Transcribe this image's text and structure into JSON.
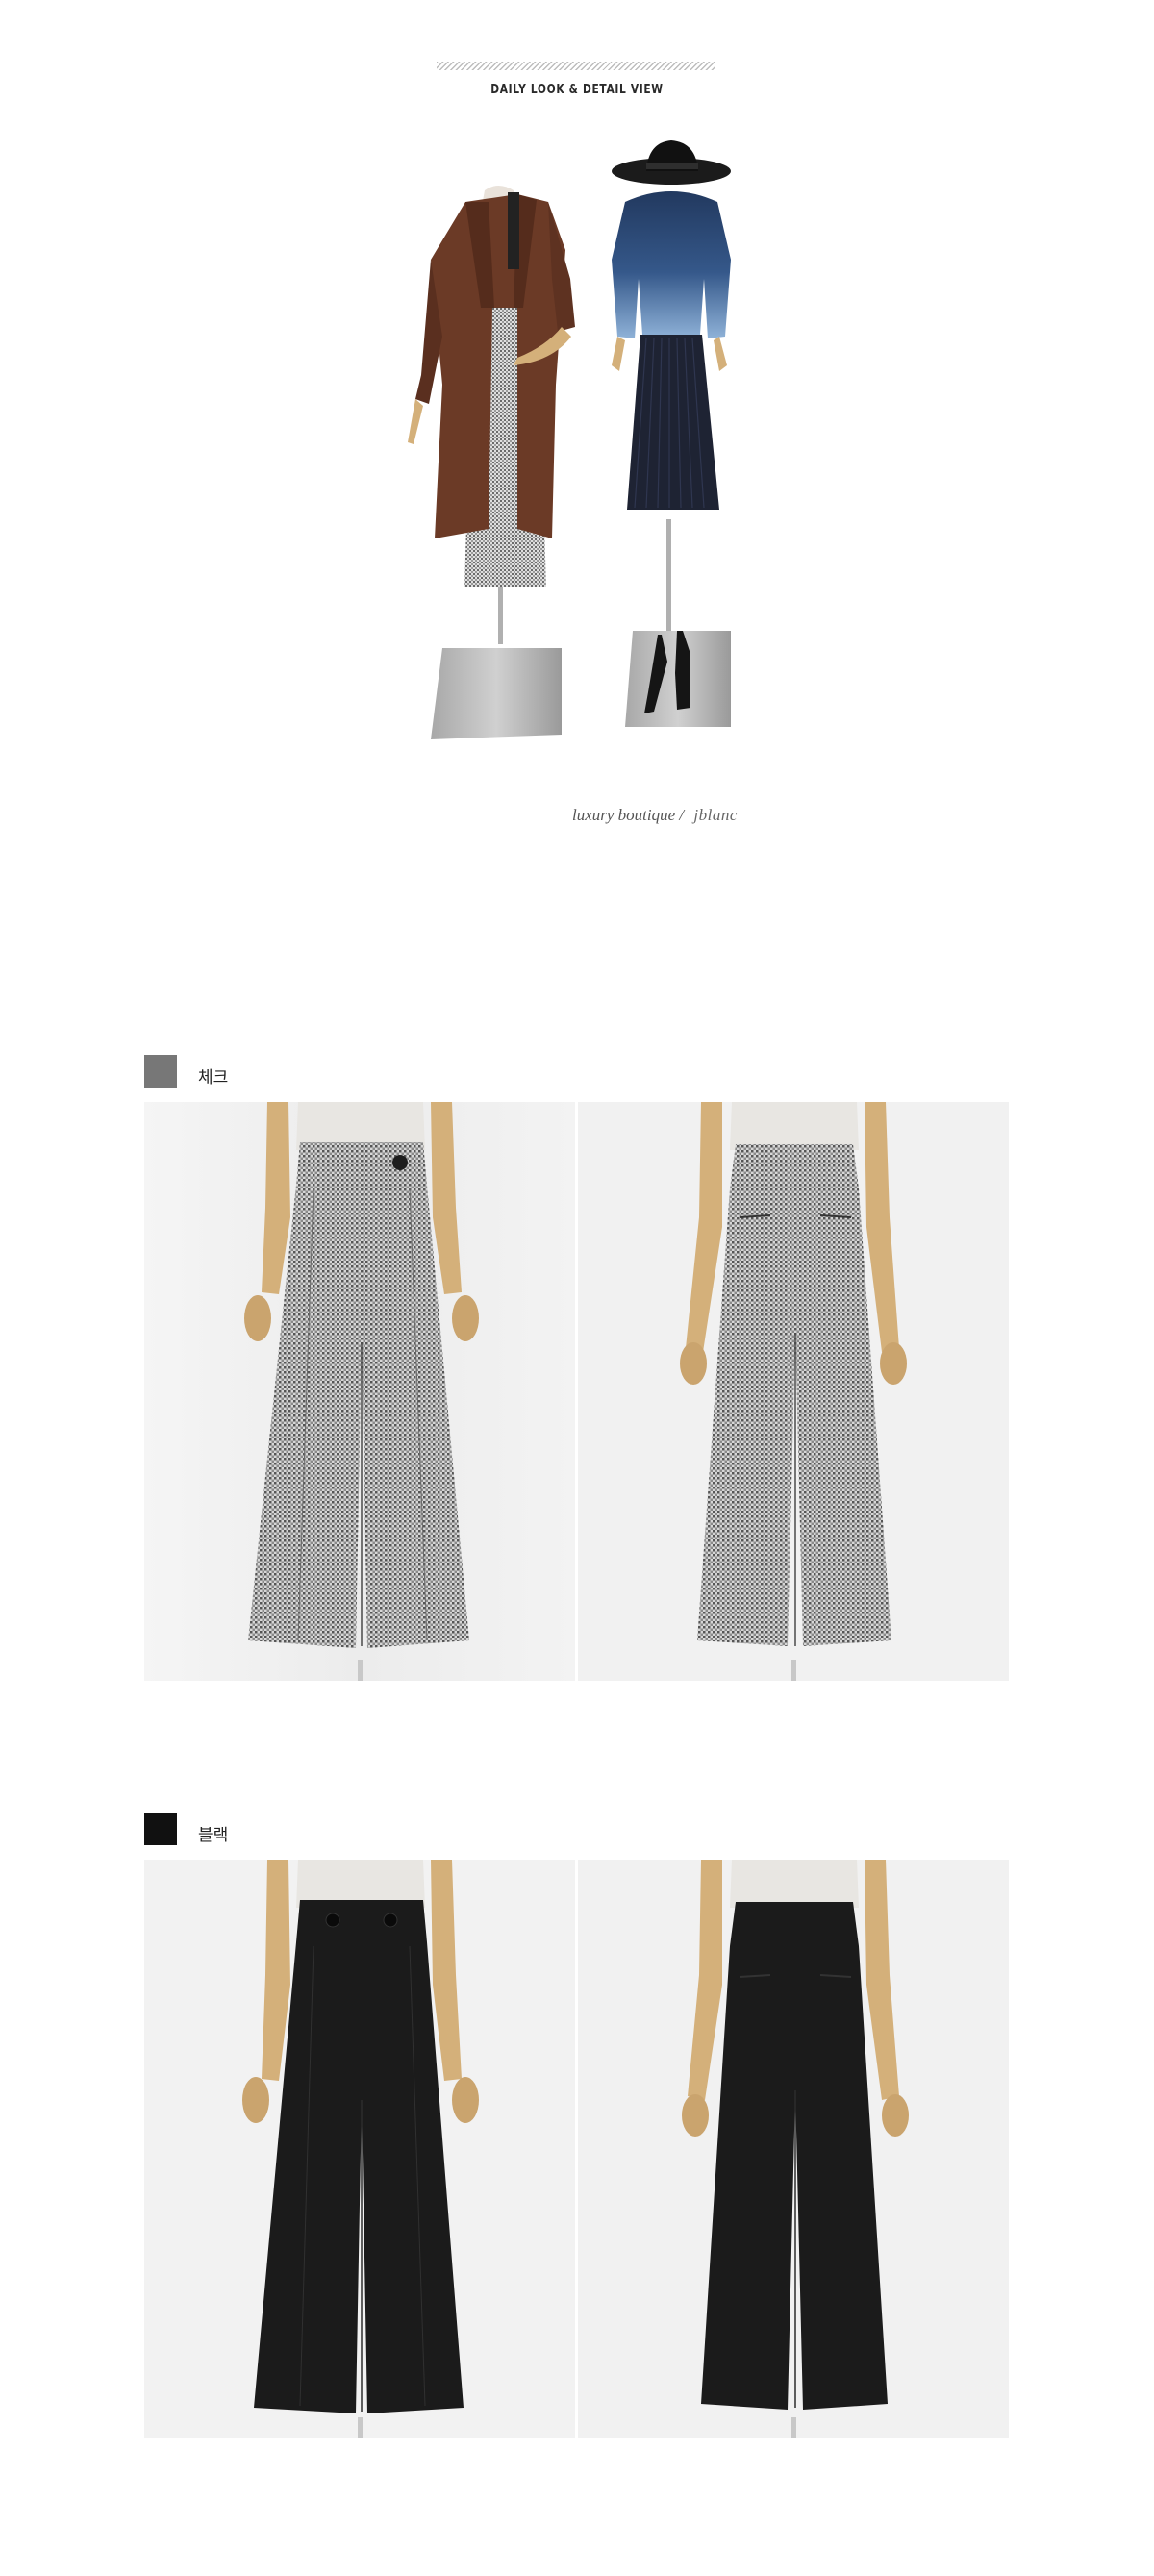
{
  "header": {
    "section_title": "DAILY LOOK & DETAIL VIEW"
  },
  "hero": {
    "caption": "luxury boutique",
    "separator": "/",
    "signature": "jblanc"
  },
  "colors": [
    {
      "label": "체크",
      "swatch": "#777777"
    },
    {
      "label": "블랙",
      "swatch": "#111111"
    }
  ],
  "palette": {
    "check_fabric": "#8c8c8c",
    "black_fabric": "#1b1b1b",
    "coat_brown": "#6b3a26",
    "sweater_blue": "#3d5f8f",
    "mannequin_wood": "#d4b07a"
  }
}
